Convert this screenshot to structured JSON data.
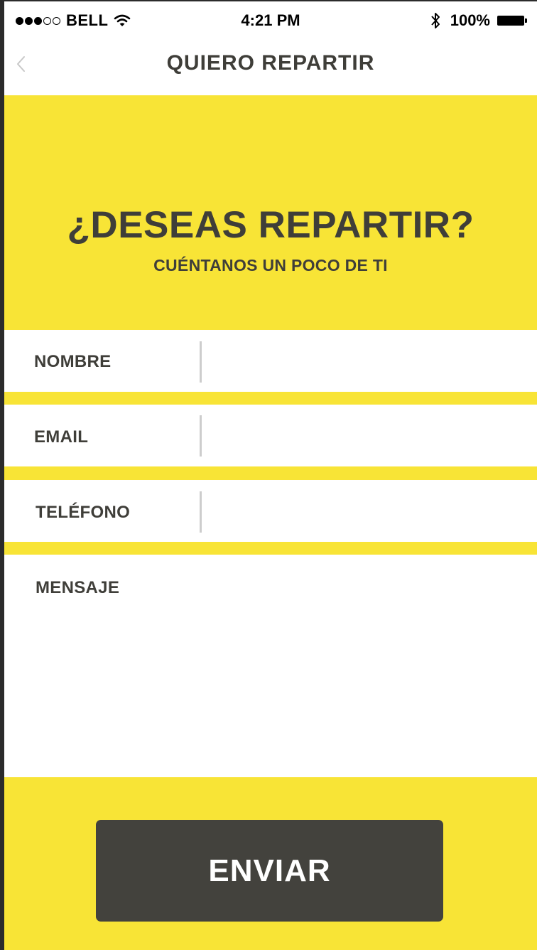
{
  "status_bar": {
    "carrier": "BELL",
    "time": "4:21 PM",
    "battery": "100%",
    "signal_strength": "3 of 5",
    "icons": [
      "signal-dots-icon",
      "wifi-icon",
      "bluetooth-icon",
      "battery-icon"
    ]
  },
  "nav": {
    "title": "QUIERO REPARTIR",
    "back_icon": "chevron-left-icon"
  },
  "hero": {
    "title": "¿DESEAS REPARTIR?",
    "subtitle": "CUÉNTANOS UN POCO DE TI"
  },
  "form": {
    "nombre_label": "NOMBRE",
    "nombre_value": "",
    "email_label": "EMAIL",
    "email_value": "",
    "telefono_label": "TELÉFONO",
    "telefono_value": "",
    "mensaje_label": "MENSAJE",
    "mensaje_value": ""
  },
  "actions": {
    "send_label": "ENVIAR"
  },
  "colors": {
    "accent_yellow": "#f8e436",
    "text_dark": "#3f3e39",
    "button_bg": "#43423d",
    "button_text": "#ffffff"
  }
}
